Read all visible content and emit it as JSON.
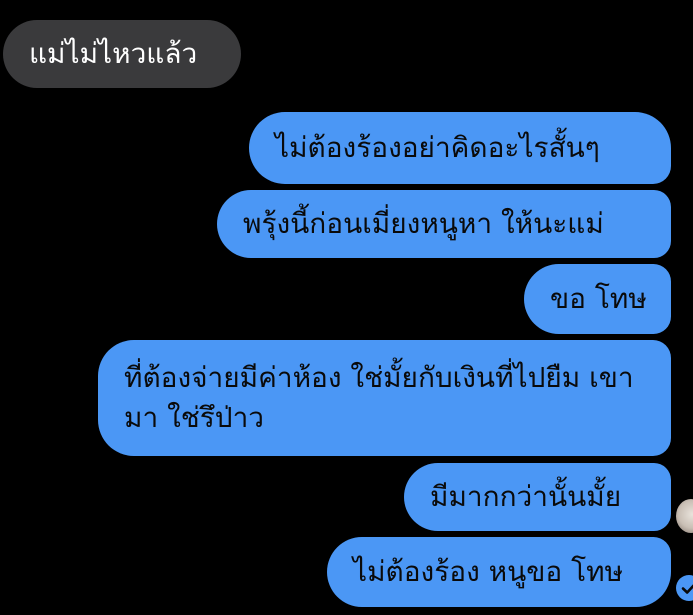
{
  "conversation": {
    "incoming": [
      {
        "text": "แม่ไม่ไหวแล้ว"
      }
    ],
    "outgoing": [
      {
        "text": "ไม่ต้องร้องอย่าคิดอะไรสั้นๆ"
      },
      {
        "text": "พรุ้งนี้ก่อนเมี่ยงหนูหา ให้นะแม่"
      },
      {
        "text": "ขอ โทษ"
      },
      {
        "text": "ที่ต้องจ่ายมีค่าห้อง ใช่มั้ยกับเงินที่ไปยืม เขามา ใช่รึป่าว"
      },
      {
        "text": "มีมากกว่านั้นมั้ย"
      },
      {
        "text": "ไม่ต้องร้อง หนูขอ โทษ"
      }
    ]
  },
  "colors": {
    "background": "#000000",
    "incoming_bubble": "#3a3a3c",
    "outgoing_bubble": "#4b97f5",
    "seen_indicator": "#4b97f5"
  },
  "icons": {
    "avatar": "contact-avatar",
    "seen": "seen-check-icon"
  }
}
